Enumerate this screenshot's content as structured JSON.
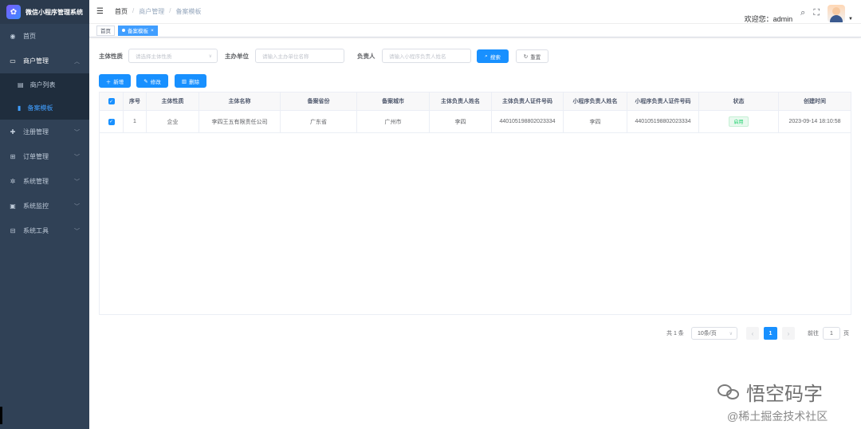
{
  "sidebar": {
    "brand": "微信小程序管理系统",
    "logo": "✿",
    "items": [
      {
        "label": "首页",
        "icon": "dashboard-icon"
      },
      {
        "label": "商户管理",
        "icon": "shop-icon"
      },
      {
        "label": "注册管理",
        "icon": "register-icon"
      },
      {
        "label": "订单管理",
        "icon": "cart-icon"
      },
      {
        "label": "系统管理",
        "icon": "gear-icon"
      },
      {
        "label": "系统监控",
        "icon": "monitor-icon"
      },
      {
        "label": "系统工具",
        "icon": "tool-icon"
      }
    ],
    "sub_items": [
      {
        "label": "商户列表",
        "icon": "list-icon"
      },
      {
        "label": "备案模板",
        "icon": "template-icon"
      }
    ]
  },
  "header": {
    "breadcrumb": [
      "首页",
      "商户管理",
      "备案模板"
    ],
    "welcome": "欢迎您：admin"
  },
  "tags": {
    "home": "首页",
    "active": "备案模板",
    "close": "×"
  },
  "filters": {
    "subject_type_label": "主体性质",
    "subject_type_placeholder": "请选择主体性质",
    "org_label": "主办单位",
    "org_placeholder": "请输入主办单位名称",
    "owner_label": "负责人",
    "owner_placeholder": "请输入小程序负责人姓名",
    "search_label": "搜索",
    "reset_label": "重置"
  },
  "toolbar": {
    "add_label": "新增",
    "edit_label": "修改",
    "delete_label": "删除"
  },
  "table": {
    "columns": [
      "序号",
      "主体性质",
      "主体名称",
      "备案省份",
      "备案城市",
      "主体负责人姓名",
      "主体负责人证件号码",
      "小程序负责人姓名",
      "小程序负责人证件号码",
      "状态",
      "创建时间"
    ],
    "rows": [
      [
        "1",
        "企业",
        "李四王五有限责任公司",
        "广东省",
        "广州市",
        "李四",
        "440105198802023334",
        "李四",
        "440105198802023334",
        "启用",
        "2023-09-14 18:10:58"
      ]
    ]
  },
  "pagination": {
    "total": "共 1 条",
    "page_size": "10条/页",
    "prev": "‹",
    "current": "1",
    "next": "›",
    "goto": "前往",
    "goto_value": "1",
    "page_suffix": "页"
  },
  "watermark": {
    "line1": "悟空码字",
    "line2": "@稀土掘金技术社区"
  },
  "colors": {
    "sidebar_bg": "#304156",
    "primary": "#1890ff",
    "success": "#13ce66"
  }
}
